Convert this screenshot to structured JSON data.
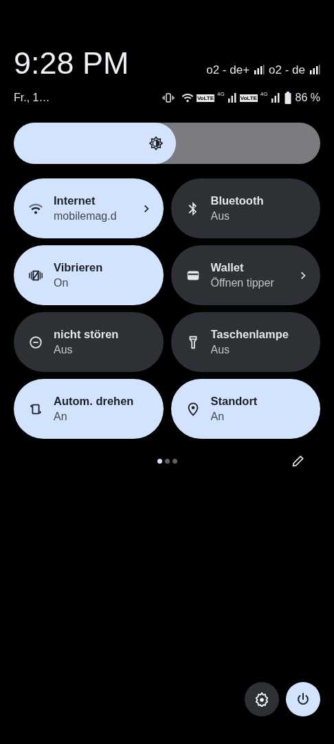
{
  "header": {
    "time": "9:28 PM",
    "date": "Fr., 1…",
    "carriers": [
      {
        "name": "o2 - de+"
      },
      {
        "name": "o2 - de"
      }
    ],
    "status_icons": [
      {
        "kind": "vibrate"
      },
      {
        "kind": "wifi"
      },
      {
        "kind": "volte",
        "text": "VoLTE"
      },
      {
        "kind": "network",
        "text": "4G"
      },
      {
        "kind": "volte",
        "text": "VoLTE"
      },
      {
        "kind": "network",
        "text": "4G"
      },
      {
        "kind": "battery"
      }
    ],
    "battery": "86 %"
  },
  "brightness": {
    "level": 0.53
  },
  "tiles": [
    {
      "kind": "wifi",
      "title": "Internet",
      "subtitle": "mobilemag.d",
      "on": true,
      "chevron": true
    },
    {
      "kind": "bluetooth",
      "title": "Bluetooth",
      "subtitle": "Aus",
      "on": false,
      "chevron": false
    },
    {
      "kind": "vibrate",
      "title": "Vibrieren",
      "subtitle": "On",
      "on": true,
      "chevron": false
    },
    {
      "kind": "wallet",
      "title": "Wallet",
      "subtitle": "Öffnen tipper",
      "on": false,
      "chevron": true
    },
    {
      "kind": "dnd",
      "title": "nicht stören",
      "subtitle": "Aus",
      "on": false,
      "chevron": false
    },
    {
      "kind": "flashlight",
      "title": "Taschenlampe",
      "subtitle": "Aus",
      "on": false,
      "chevron": false
    },
    {
      "kind": "rotate",
      "title": "Autom. drehen",
      "subtitle": "An",
      "on": true,
      "chevron": false
    },
    {
      "kind": "location",
      "title": "Standort",
      "subtitle": "An",
      "on": true,
      "chevron": false
    }
  ],
  "pages": [
    {
      "selected": true
    },
    {
      "selected": false
    },
    {
      "selected": false
    }
  ],
  "buttons": [
    {
      "kind": "settings"
    },
    {
      "kind": "power"
    }
  ]
}
